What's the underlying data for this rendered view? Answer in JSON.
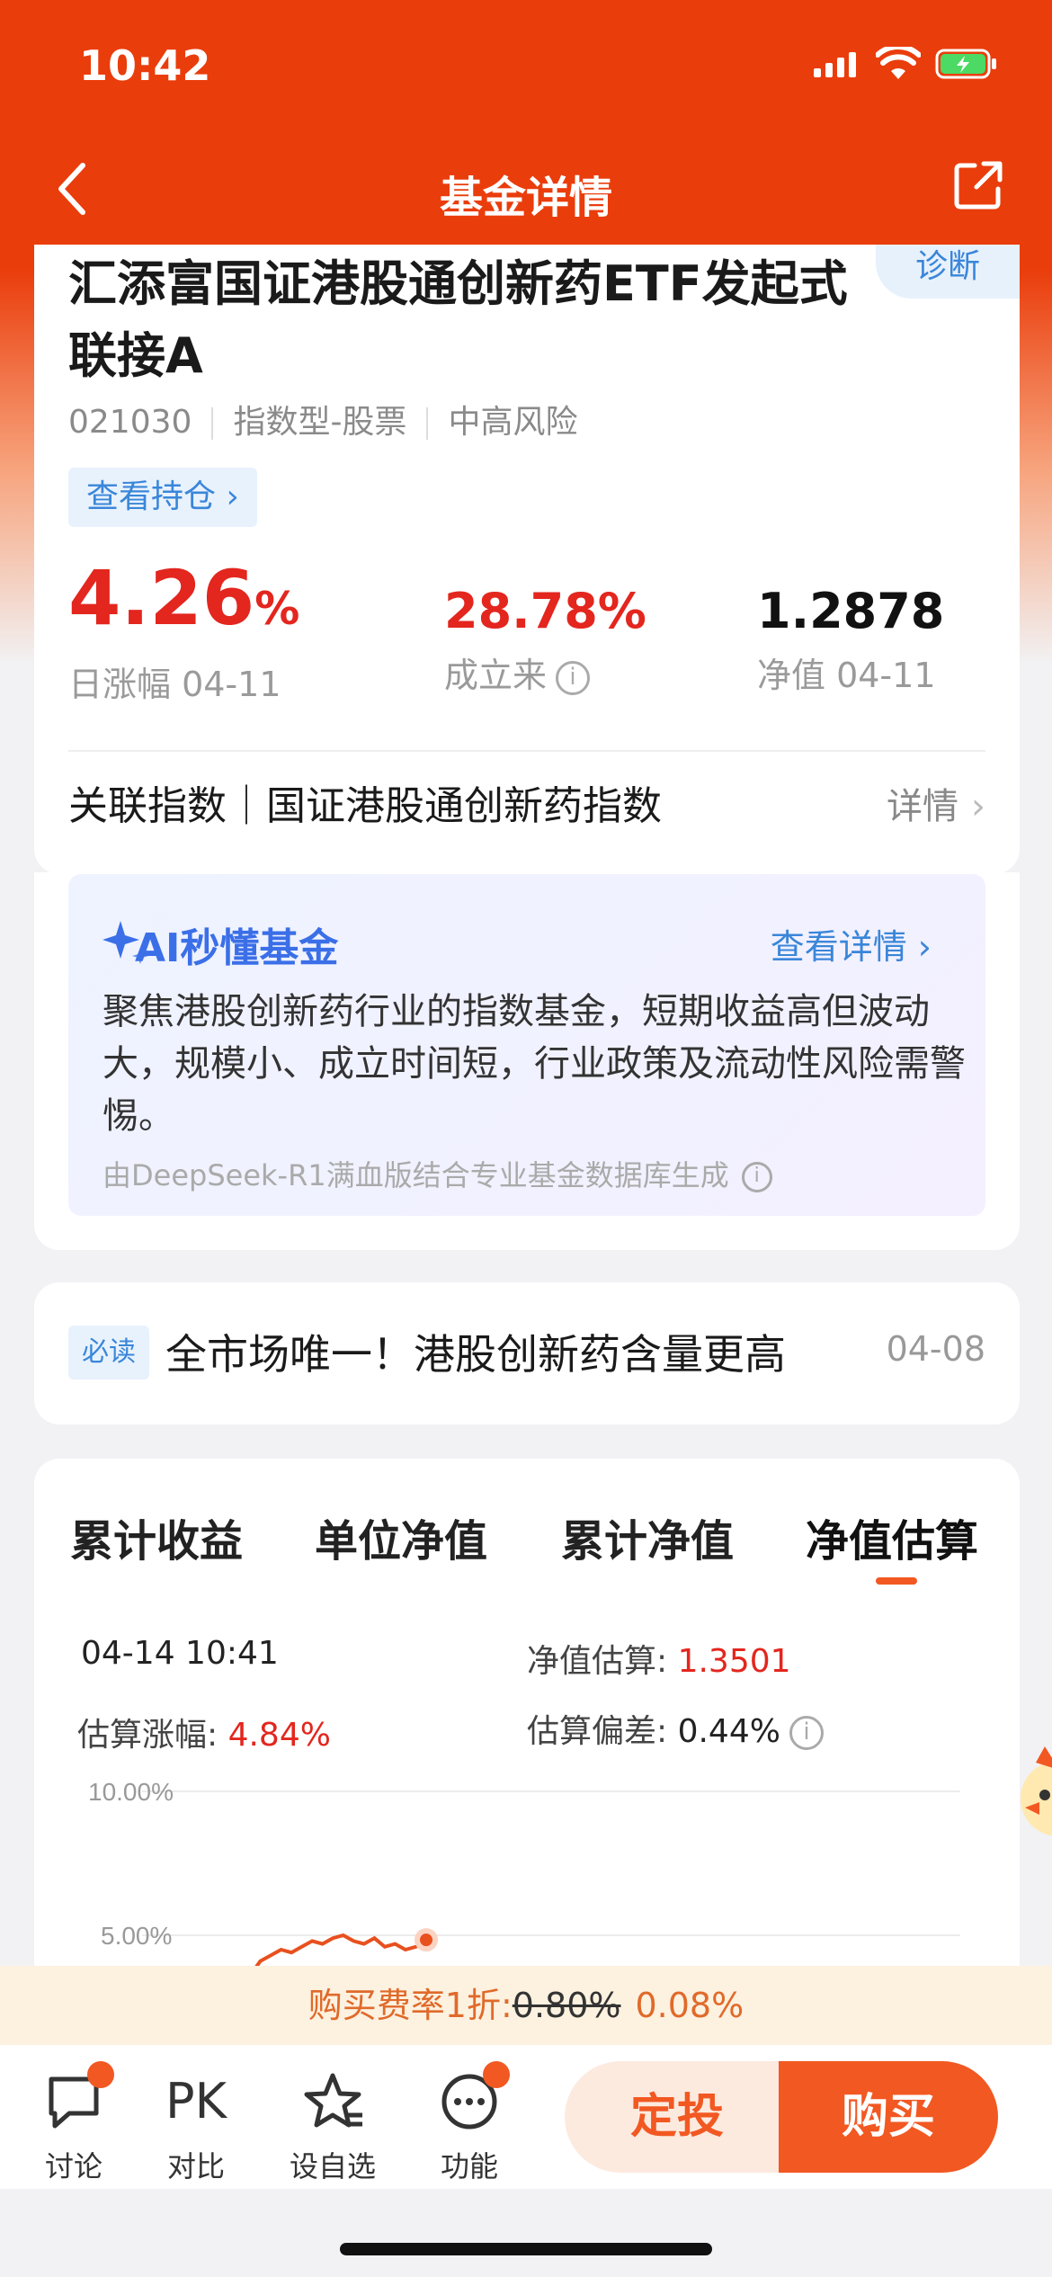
{
  "status": {
    "time": "10:42"
  },
  "nav": {
    "title": "基金详情"
  },
  "fund": {
    "name": "汇添富国证港股通创新药ETF发起式联接A",
    "diagnose": "诊断",
    "code": "021030",
    "type": "指数型-股票",
    "risk": "中高风险",
    "holdings_btn": "查看持仓 ›",
    "daily_change": "4.26",
    "daily_change_unit": "%",
    "daily_label": "日涨幅 04-11",
    "since_inception": "28.78%",
    "since_label": "成立来",
    "nav_value": "1.2878",
    "nav_label": "净值 04-11",
    "index_label": "关联指数｜国证港股通创新药指数",
    "index_more": "详情"
  },
  "ai": {
    "title": "AI秒懂基金",
    "more": "查看详情 ›",
    "text": "聚焦港股创新药行业的指数基金，短期收益高但波动大，规模小、成立时间短，行业政策及流动性风险需警惕。",
    "source": "由DeepSeek-R1满血版结合专业基金数据库生成"
  },
  "news": {
    "badge": "必读",
    "title": "全市场唯一！港股创新药含量更高",
    "date": "04-08"
  },
  "tabs": [
    "累计收益",
    "单位净值",
    "累计净值",
    "净值估算"
  ],
  "estimate": {
    "time": "04-14 10:41",
    "est_label": "净值估算: ",
    "est_value": "1.3501",
    "chg_label": "估算涨幅: ",
    "chg_value": "4.84%",
    "dev_label": "估算偏差: ",
    "dev_value": "0.44%"
  },
  "chart_data": {
    "type": "line",
    "yticks": [
      "10.00%",
      "5.00%"
    ],
    "ylim": [
      0,
      10
    ],
    "series": [
      {
        "values": [
          3.6,
          4.1,
          4.3,
          4.5,
          4.4,
          4.6,
          4.8,
          4.7,
          4.9,
          5.0,
          4.8,
          4.7,
          4.9,
          4.6,
          4.7,
          4.5,
          4.6,
          4.84
        ]
      }
    ],
    "grid": true
  },
  "promo": {
    "prefix": "购买费率1折:",
    "old_rate": "0.80%",
    "new_rate": "0.08%"
  },
  "bottom": {
    "discuss": "讨论",
    "compare_icon": "PK",
    "compare": "对比",
    "watch": "设自选",
    "functions": "功能",
    "invest": "定投",
    "buy": "购买"
  },
  "colors": {
    "brand": "#ea3d0c",
    "up": "#e3261e",
    "accent": "#f25822",
    "link": "#3a86d9"
  }
}
